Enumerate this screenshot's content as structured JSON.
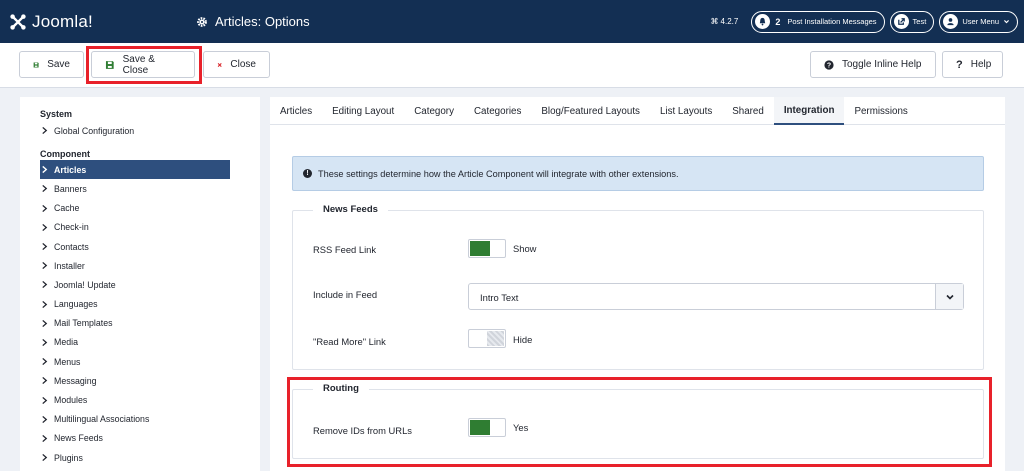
{
  "header": {
    "logo_text": "Joomla!",
    "page_title": "Articles: Options",
    "version": "4.2.7",
    "notifications": {
      "count": "2",
      "label": "Post Installation Messages"
    },
    "site_label": "Test",
    "user_menu_label": "User Menu"
  },
  "toolbar": {
    "save_label": "Save",
    "save_close_label": "Save & Close",
    "close_label": "Close",
    "inline_help_label": "Toggle Inline Help",
    "help_label": "Help"
  },
  "sidebar": {
    "system_heading": "System",
    "system_items": [
      {
        "label": "Global Configuration"
      }
    ],
    "component_heading": "Component",
    "component_items": [
      {
        "label": "Articles",
        "active": true
      },
      {
        "label": "Banners"
      },
      {
        "label": "Cache"
      },
      {
        "label": "Check-in"
      },
      {
        "label": "Contacts"
      },
      {
        "label": "Installer"
      },
      {
        "label": "Joomla! Update"
      },
      {
        "label": "Languages"
      },
      {
        "label": "Mail Templates"
      },
      {
        "label": "Media"
      },
      {
        "label": "Menus"
      },
      {
        "label": "Messaging"
      },
      {
        "label": "Modules"
      },
      {
        "label": "Multilingual Associations"
      },
      {
        "label": "News Feeds"
      },
      {
        "label": "Plugins"
      }
    ]
  },
  "tabs": [
    {
      "label": "Articles"
    },
    {
      "label": "Editing Layout"
    },
    {
      "label": "Category"
    },
    {
      "label": "Categories"
    },
    {
      "label": "Blog/Featured Layouts"
    },
    {
      "label": "List Layouts"
    },
    {
      "label": "Shared"
    },
    {
      "label": "Integration",
      "active": true
    },
    {
      "label": "Permissions"
    }
  ],
  "info_message": "These settings determine how the Article Component will integrate with other extensions.",
  "news_feeds": {
    "legend": "News Feeds",
    "rss_feed_link": {
      "label": "RSS Feed Link",
      "value": "Show"
    },
    "include_in_feed": {
      "label": "Include in Feed",
      "value": "Intro Text"
    },
    "read_more_link": {
      "label": "\"Read More\" Link",
      "value": "Hide"
    }
  },
  "routing": {
    "legend": "Routing",
    "remove_ids": {
      "label": "Remove IDs from URLs",
      "value": "Yes"
    }
  },
  "colors": {
    "header_bg": "#132f53",
    "active_nav": "#2e4f7e",
    "switch_on": "#2f7d32",
    "highlight": "#e8212a",
    "info_bg": "#d6e5f4"
  },
  "icons": {
    "logo": "joomla-logo-icon",
    "title": "gear-icon",
    "save": "floppy-disk-icon",
    "close": "x-icon",
    "help": "question-icon",
    "chevron": "chevron-right-icon",
    "dropdown": "chevron-down-icon"
  }
}
